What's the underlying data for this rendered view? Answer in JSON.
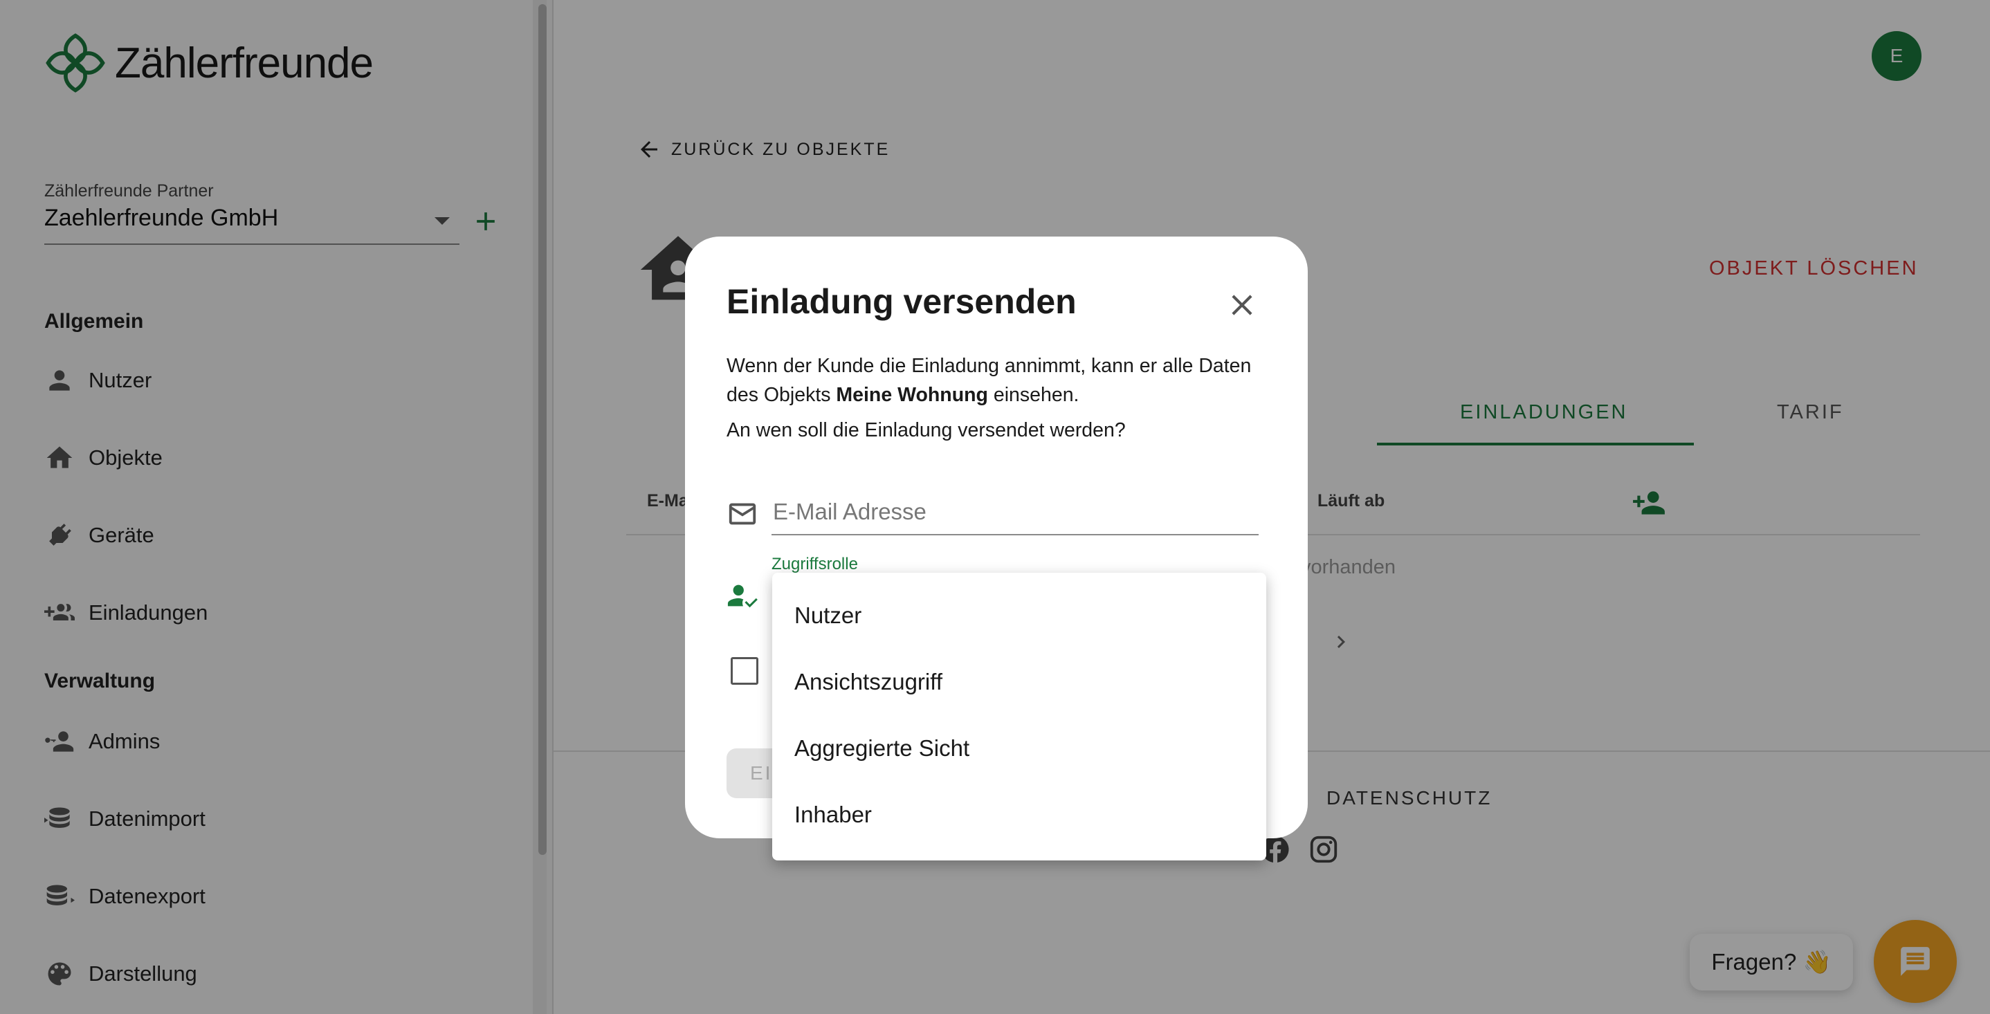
{
  "sidebar": {
    "brand": "Zählerfreunde",
    "partner_label": "Zählerfreunde Partner",
    "partner_value": "Zaehlerfreunde GmbH",
    "section_general": "Allgemein",
    "section_admin": "Verwaltung",
    "items": [
      {
        "label": "Nutzer",
        "icon": "person-icon"
      },
      {
        "label": "Objekte",
        "icon": "home-icon"
      },
      {
        "label": "Geräte",
        "icon": "plug-icon"
      },
      {
        "label": "Einladungen",
        "icon": "group-add-icon"
      },
      {
        "label": "Admins",
        "icon": "key-person-icon"
      },
      {
        "label": "Datenimport",
        "icon": "database-import-icon"
      },
      {
        "label": "Datenexport",
        "icon": "database-export-icon"
      },
      {
        "label": "Darstellung",
        "icon": "palette-icon"
      }
    ]
  },
  "header": {
    "avatar_initial": "E",
    "back_label": "ZURÜCK ZU OBJEKTE",
    "delete_label": "OBJEKT LÖSCHEN"
  },
  "tabs": [
    {
      "label": "EINLADUNGEN",
      "active": true
    },
    {
      "label": "TARIF",
      "active": false
    }
  ],
  "table": {
    "col_email": "E-Mail",
    "col_expires": "Läuft ab",
    "empty_text": "vorhanden"
  },
  "footer": {
    "privacy_label": "DATENSCHUTZ"
  },
  "chat": {
    "bubble_text": "Fragen? 👋"
  },
  "dialog": {
    "title": "Einladung versenden",
    "text_before": "Wenn der Kunde die Einladung annimmt, kann er alle Daten des Objekts ",
    "object_name": "Meine Wohnung",
    "text_after": " einsehen.",
    "question": "An wen soll die Einladung versendet werden?",
    "email_placeholder": "E-Mail Adresse",
    "role_label": "Zugriffsrolle",
    "send_label": "EINLADEN"
  },
  "role_menu": {
    "options": [
      "Nutzer",
      "Ansichtszugriff",
      "Aggregierte Sicht",
      "Inhaber"
    ]
  },
  "colors": {
    "brand_green": "#1b7a3e",
    "danger_red": "#d32f2f",
    "chat_orange": "#f5a623"
  }
}
